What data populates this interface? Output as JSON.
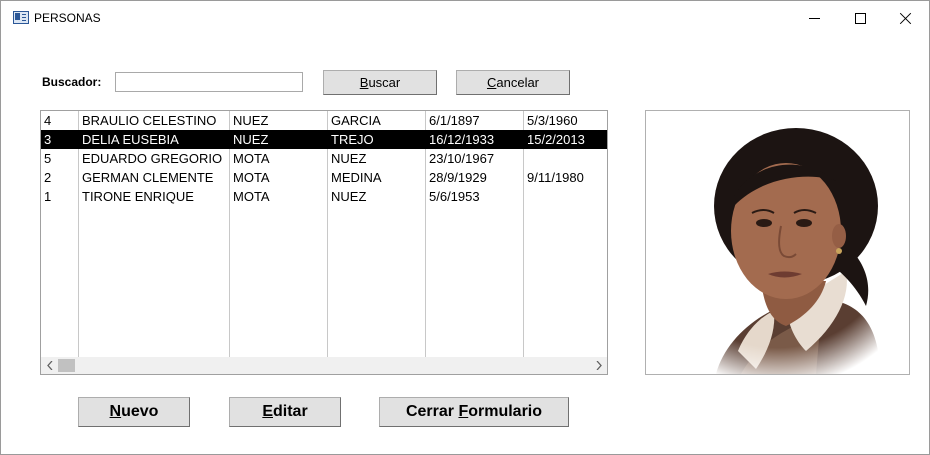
{
  "window": {
    "title": "PERSONAS",
    "icons": {
      "app": "form-icon",
      "minimize": "minimize-icon",
      "maximize": "maximize-icon",
      "close": "close-icon"
    }
  },
  "search": {
    "label": "Buscador:",
    "value": "",
    "placeholder": "",
    "search_button": {
      "pre": "",
      "key": "B",
      "post": "uscar"
    },
    "cancel_button": {
      "pre": "",
      "key": "C",
      "post": "ancelar"
    }
  },
  "list": {
    "rows": [
      [
        "4",
        "BRAULIO CELESTINO",
        "NUEZ",
        "GARCIA",
        "6/1/1897",
        "5/3/1960"
      ],
      [
        "3",
        "DELIA EUSEBIA",
        "NUEZ",
        "TREJO",
        "16/12/1933",
        "15/2/2013"
      ],
      [
        "5",
        "EDUARDO GREGORIO",
        "MOTA",
        "NUEZ",
        "23/10/1967",
        ""
      ],
      [
        "2",
        "GERMAN CLEMENTE",
        "MOTA",
        "MEDINA",
        "28/9/1929",
        "9/11/1980"
      ],
      [
        "1",
        "TIRONE ENRIQUE",
        "MOTA",
        "NUEZ",
        "5/6/1953",
        ""
      ]
    ],
    "selected_index": 1,
    "scroll_left_icon": "chevron-left-icon",
    "scroll_right_icon": "chevron-right-icon"
  },
  "photo": {
    "subject": "portrait of a woman"
  },
  "actions": {
    "new_button": {
      "pre": "",
      "key": "N",
      "post": "uevo"
    },
    "edit_button": {
      "pre": "",
      "key": "E",
      "post": "ditar"
    },
    "close_form_button": {
      "pre": "Cerrar ",
      "key": "F",
      "post": "ormulario"
    }
  }
}
